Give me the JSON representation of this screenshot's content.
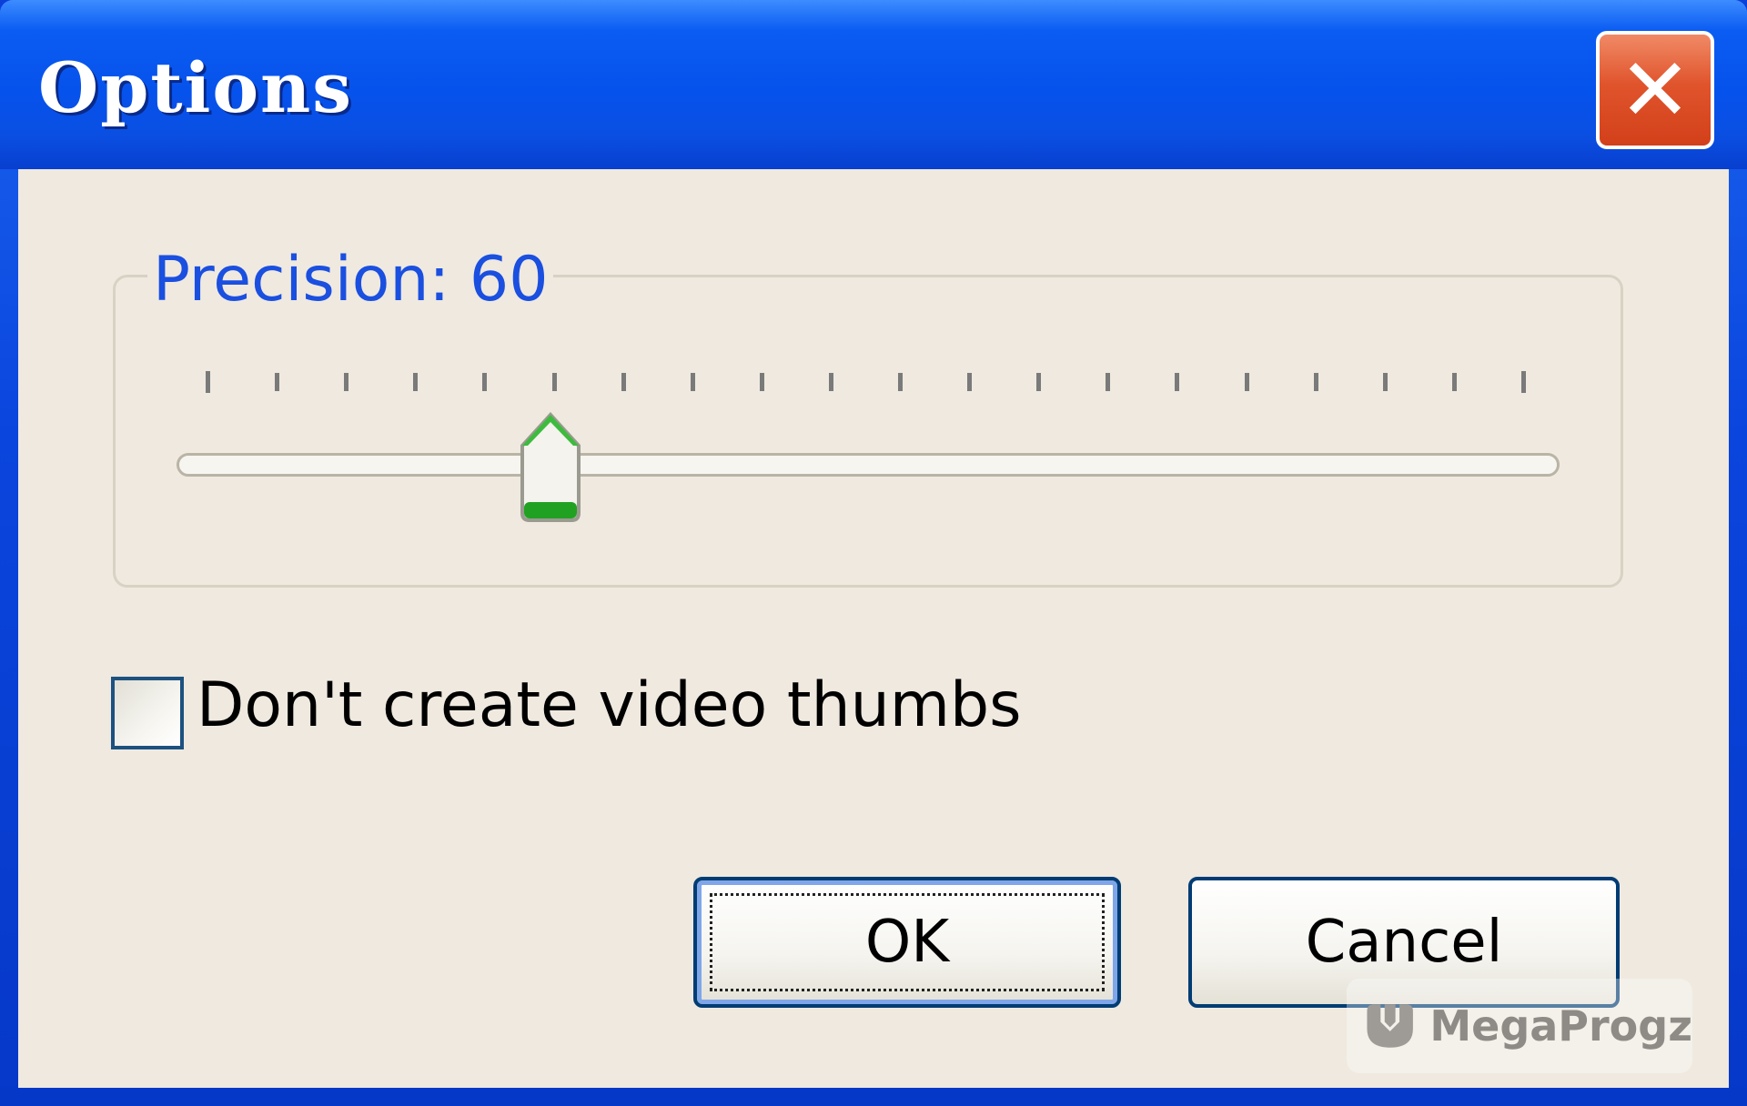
{
  "window": {
    "title": "Options",
    "close_glyph": "✕",
    "titlebar_color": "#0652ec",
    "client_color": "#efe9df"
  },
  "precision": {
    "label": "Precision: 60",
    "value": 60,
    "tick_count": 20
  },
  "options": {
    "dont_create_thumbs_label": "Don't create video thumbs",
    "dont_create_thumbs_checked": false
  },
  "buttons": {
    "ok_label": "OK",
    "cancel_label": "Cancel"
  },
  "watermark": {
    "text": "MegaProgz",
    "icon": "megaprogz-logo-icon"
  }
}
